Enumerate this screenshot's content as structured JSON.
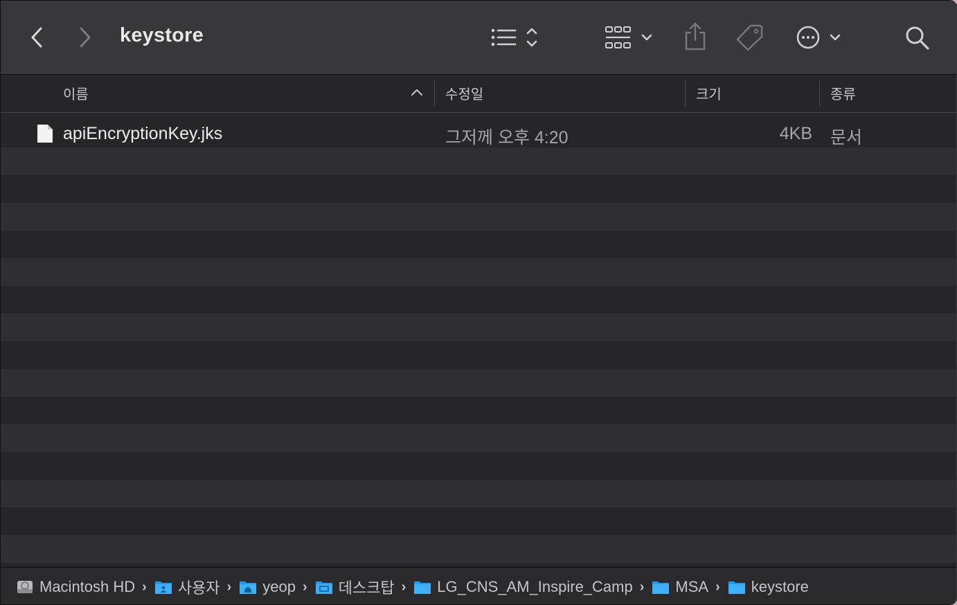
{
  "window": {
    "title": "keystore"
  },
  "toolbar": {
    "back_icon": "chevron-left-icon",
    "forward_icon": "chevron-right-icon",
    "list_view_icon": "list-icon",
    "grid_view_icon": "grid-icon",
    "share_icon": "share-icon",
    "tag_icon": "tag-icon",
    "more_icon": "ellipsis-circle-icon",
    "search_icon": "search-icon"
  },
  "columns": {
    "name": "이름",
    "modified": "수정일",
    "size": "크기",
    "kind": "종류"
  },
  "files": [
    {
      "name": "apiEncryptionKey.jks",
      "modified": "그저께 오후 4:20",
      "size": "4KB",
      "kind": "문서"
    }
  ],
  "path": [
    {
      "label": "Macintosh HD",
      "icon": "hard-drive-icon"
    },
    {
      "label": "사용자",
      "icon": "users-folder-icon"
    },
    {
      "label": "yeop",
      "icon": "home-folder-icon"
    },
    {
      "label": "데스크탑",
      "icon": "desktop-folder-icon"
    },
    {
      "label": "LG_CNS_AM_Inspire_Camp",
      "icon": "folder-icon"
    },
    {
      "label": "MSA",
      "icon": "folder-icon"
    },
    {
      "label": "keystore",
      "icon": "folder-icon"
    }
  ],
  "path_separator": "›",
  "colors": {
    "accent_folder": "#1e9bf0",
    "window_bg": "#262528",
    "toolbar_bg": "#38373a"
  }
}
